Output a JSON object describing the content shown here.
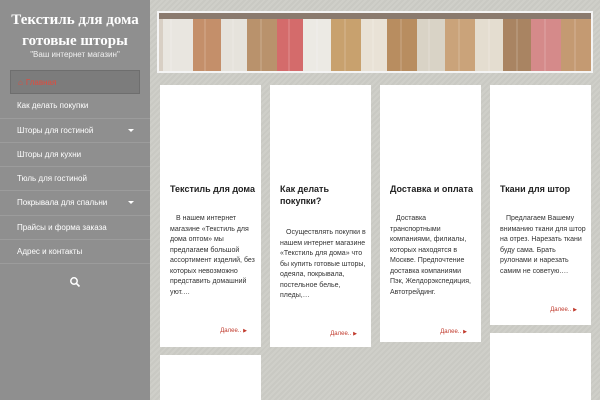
{
  "site": {
    "title_line1": "Текстиль для дома",
    "title_line2": "готовые шторы",
    "tagline": "\"Ваш интернет магазин\""
  },
  "menu": [
    {
      "label": "Главная",
      "active": true
    },
    {
      "label": "Как делать покупки",
      "active": false
    },
    {
      "label": "Шторы для гостиной",
      "active": false,
      "submenu": true
    },
    {
      "label": "Шторы для кухни",
      "active": false
    },
    {
      "label": "Тюль для гостиной",
      "active": false
    },
    {
      "label": "Покрывала для спальни",
      "active": false,
      "submenu": true
    },
    {
      "label": "Прайсы и форма заказа",
      "active": false
    },
    {
      "label": "Адрес и контакты",
      "active": false
    }
  ],
  "cards": [
    {
      "title": "Текстиль для дома",
      "text": "В нашем интернет магазине «Текстиль для дома оптом» мы предлагаем большой ассортимент изделий, без которых невозможно представить домашний уют.…",
      "more": "Далее.."
    },
    {
      "title": "Как делать покупки?",
      "text": "Осуществлять покупки в нашем интернет магазине «Текстиль для дома» что бы купить готовые шторы, одеяла, покрывала, постельное белье, пледы,…",
      "more": "Далее.."
    },
    {
      "title": "Доставка и оплата",
      "text": "Доставка транспортными компаниями, филиалы, которых находятся в Москве. Предпочтение доставка компаниями Пэк, Желдорэкспедиция, Автотрейдинг.",
      "more": "Далее.."
    },
    {
      "title": "Ткани для штор",
      "text": "Предлагаем Вашему вниманию ткани для штор на отрез. Нарезать ткани буду сама. Брать рулонами и нарезать самим не советую.…",
      "more": "Далее.."
    }
  ],
  "colors": {
    "accent": "#e14b3d",
    "sidebar": "#8f8f8f",
    "background": "#cfcfc9"
  }
}
